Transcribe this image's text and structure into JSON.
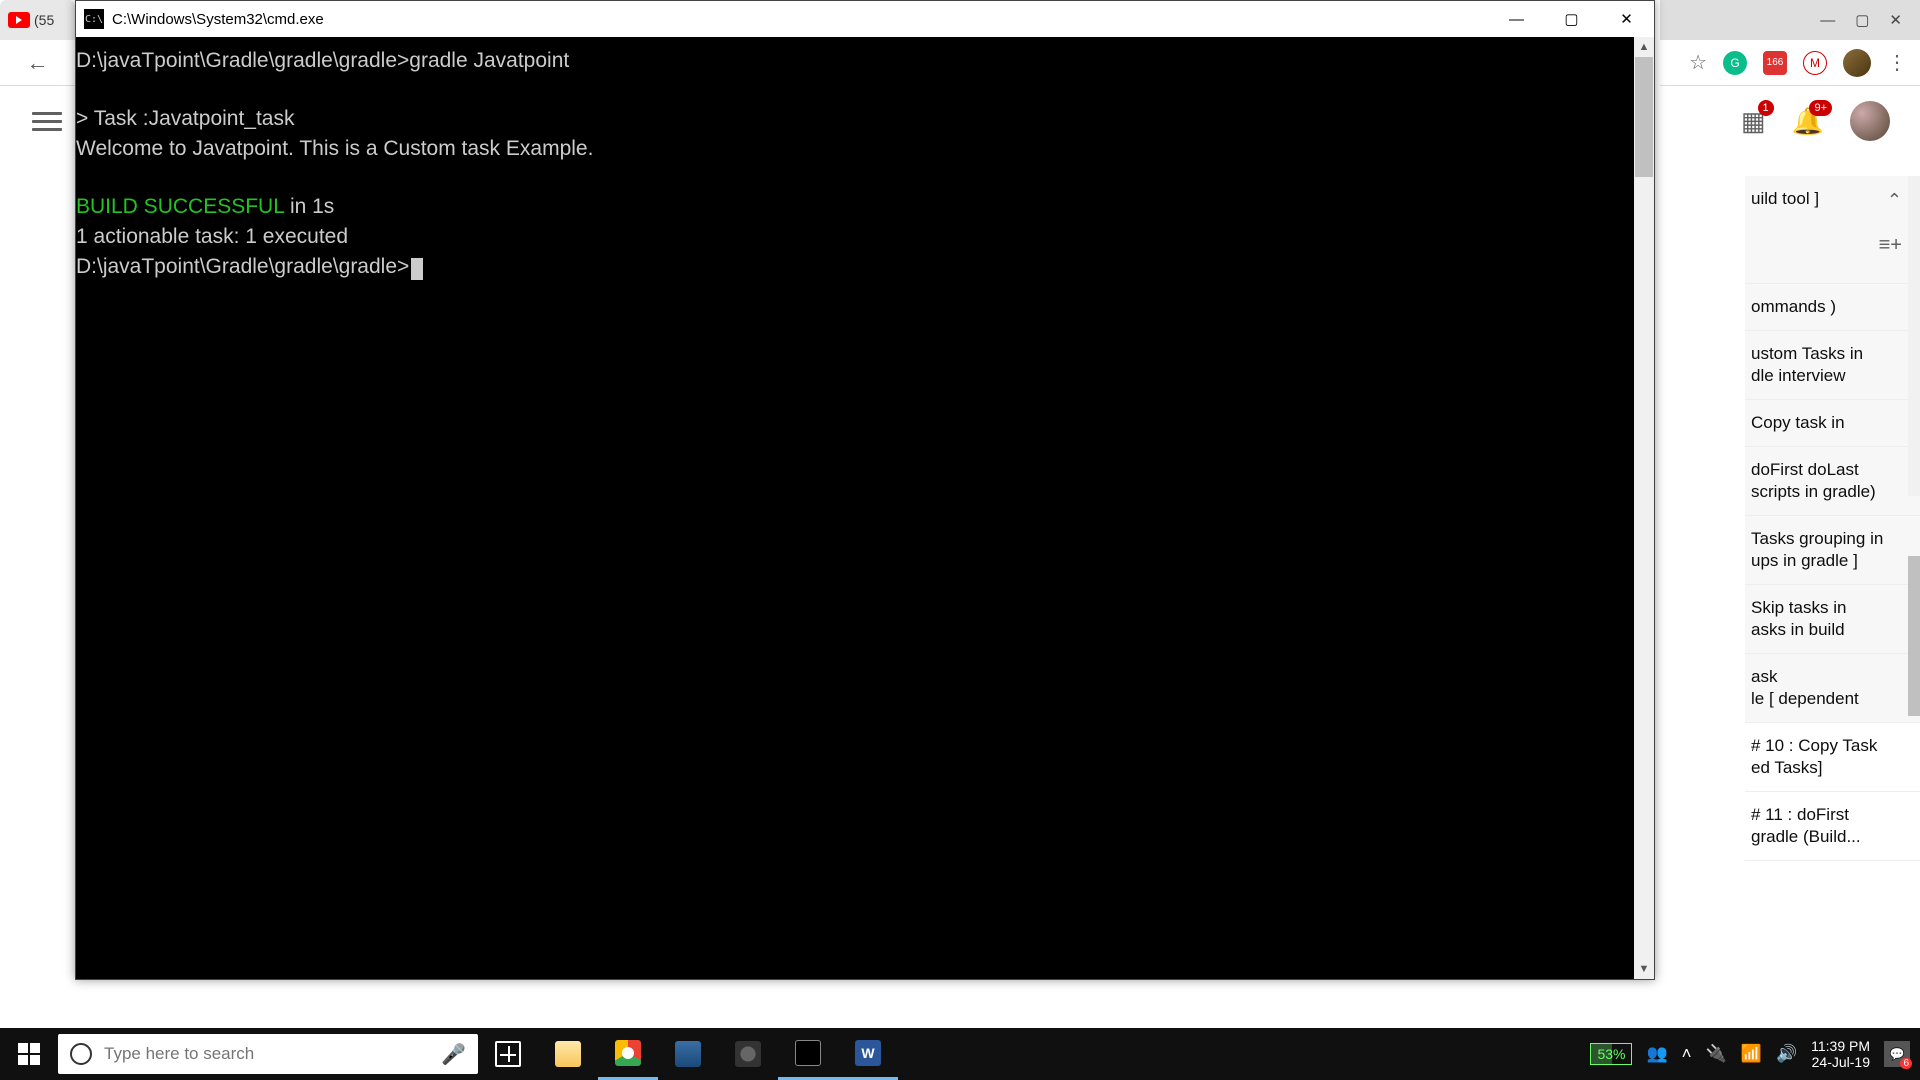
{
  "browser": {
    "tab_text": "(55",
    "nav": {
      "back": "←"
    },
    "window_buttons": {
      "min": "—",
      "max": "▢",
      "close": "✕"
    },
    "ext_badge": "166",
    "yt": {
      "apps_badge": "1",
      "bell_badge": "9+"
    }
  },
  "cmd": {
    "title": "C:\\Windows\\System32\\cmd.exe",
    "line1": "D:\\javaTpoint\\Gradle\\gradle\\gradle>gradle Javatpoint",
    "line_task": "> Task :Javatpoint_task",
    "line_welcome": "Welcome to Javatpoint. This is a Custom task Example.",
    "build_success": "BUILD SUCCESSFUL",
    "build_suffix": " in 1s",
    "line_actionable": "1 actionable task: 1 executed",
    "prompt2": "D:\\javaTpoint\\Gradle\\gradle\\gradle>",
    "btn_min": "—",
    "btn_max": "▢",
    "btn_close": "✕"
  },
  "sidebar": {
    "items": [
      "uild tool ]",
      "ommands )",
      "ustom Tasks in\ndle interview",
      "Copy task in",
      "doFirst doLast\nscripts in gradle)",
      "Tasks grouping in\nups in gradle ]",
      "Skip tasks in\nasks in build",
      "ask\nle [ dependent",
      "# 10 : Copy Task\ned Tasks]",
      "# 11 : doFirst\n gradle (Build..."
    ]
  },
  "taskbar": {
    "search_placeholder": "Type here to search",
    "battery": "53%",
    "time": "11:39 PM",
    "date": "24-Jul-19",
    "notif_count": "6",
    "word_label": "W"
  }
}
